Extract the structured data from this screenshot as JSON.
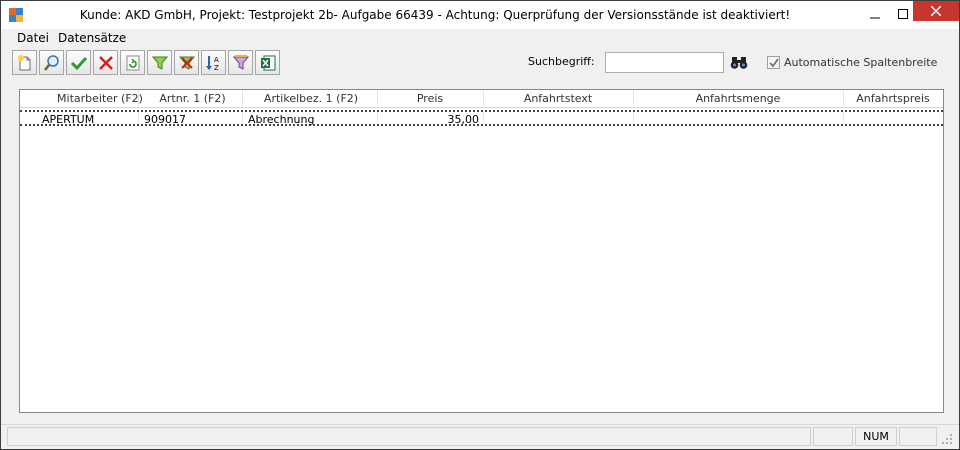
{
  "window": {
    "title": "Kunde: AKD GmbH, Projekt: Testprojekt 2b- Aufgabe 66439 - Achtung: Querprüfung der Versionsstände ist deaktiviert!"
  },
  "menu": {
    "items": [
      {
        "label": "Datei"
      },
      {
        "label": "Datensätze"
      }
    ]
  },
  "toolbar": {
    "buttons": [
      {
        "icon": "new-record-icon"
      },
      {
        "icon": "magnifier-icon"
      },
      {
        "icon": "checkmark-icon"
      },
      {
        "icon": "delete-icon"
      },
      {
        "icon": "refresh-icon"
      },
      {
        "icon": "filter-icon"
      },
      {
        "icon": "remove-filter-icon"
      },
      {
        "icon": "sort-az-icon"
      },
      {
        "icon": "filter-edit-icon"
      },
      {
        "icon": "excel-export-icon"
      }
    ]
  },
  "search": {
    "label": "Suchbegriff:",
    "value": "",
    "button_icon": "binoculars-icon"
  },
  "auto_width": {
    "label": "Automatische Spaltenbreite",
    "checked": true
  },
  "grid": {
    "columns": [
      "Mitarbeiter (F2)",
      "Artnr. 1 (F2)",
      "Artikelbez. 1 (F2)",
      "Preis",
      "Anfahrtstext",
      "Anfahrtsmenge",
      "Anfahrtspreis"
    ],
    "rows": [
      [
        "APERTUM",
        "909017",
        "Abrechnung",
        "35,00",
        "",
        "",
        ""
      ]
    ]
  },
  "status": {
    "num": "NUM"
  },
  "colors": {
    "close_button": "#c7372f",
    "toolbar_green": "#2e9b2e",
    "toolbar_red": "#d22020"
  }
}
